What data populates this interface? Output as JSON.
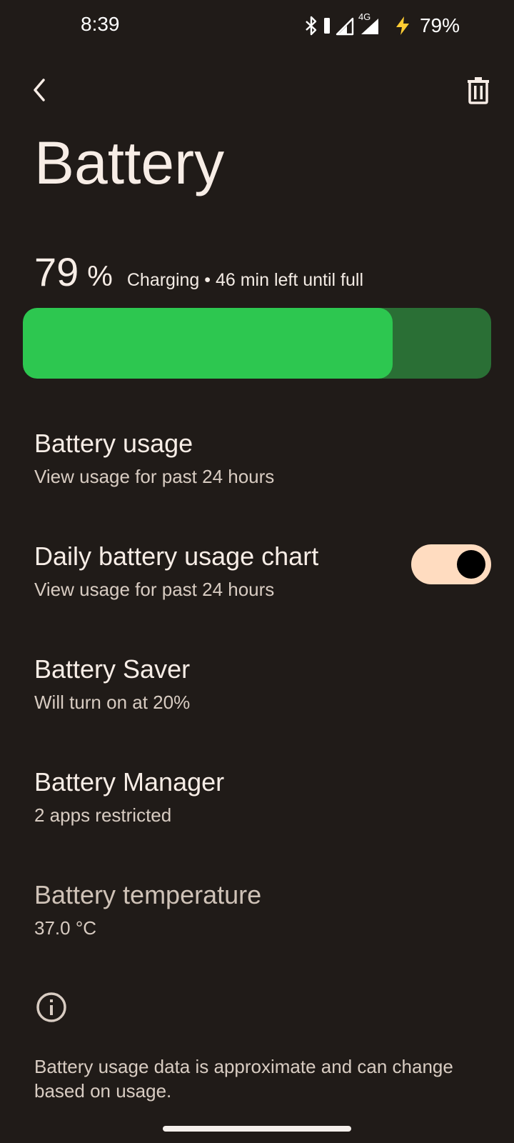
{
  "status_bar": {
    "time": "8:39",
    "network_label": "4G",
    "battery_percent": "79%",
    "icons": [
      "bluetooth-icon",
      "vibrate-icon",
      "signal-icon",
      "signal-4g-icon",
      "charging-bolt-icon"
    ]
  },
  "header": {
    "back_icon": "chevron-left-icon",
    "action_icon": "trash-icon",
    "title": "Battery"
  },
  "battery": {
    "level_number": "79",
    "level_unit": "%",
    "status": "Charging • 46 min left until full",
    "level_fraction": 0.79,
    "fill_color": "#2dc750",
    "track_color": "#2a6f35"
  },
  "settings": [
    {
      "title": "Battery usage",
      "summary": "View usage for past 24 hours"
    },
    {
      "title": "Daily battery usage chart",
      "summary": "View usage for past 24 hours",
      "toggle_on": true
    },
    {
      "title": "Battery Saver",
      "summary": "Will turn on at 20%"
    },
    {
      "title": "Battery Manager",
      "summary": "2 apps restricted"
    },
    {
      "title": "Battery temperature",
      "summary": "37.0 °C"
    }
  ],
  "footer": {
    "icon": "info-icon",
    "text": "Battery usage data is approximate and can change based on usage."
  },
  "colors": {
    "background": "#201b18",
    "toggle_track": "#ffdcc0",
    "toggle_thumb": "#000000"
  }
}
